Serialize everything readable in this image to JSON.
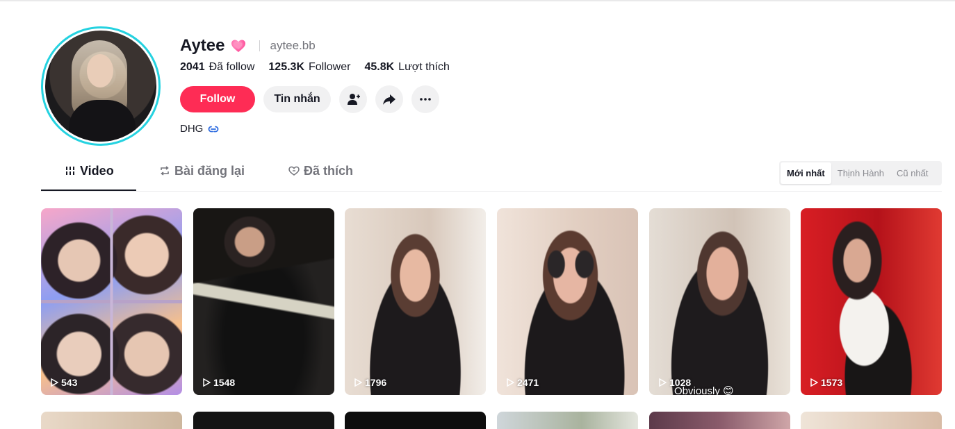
{
  "profile": {
    "name": "Aytee",
    "handle": "aytee.bb",
    "heart_icon": "pink-heart-emoji",
    "stats": [
      {
        "value": "2041",
        "label": "Đã follow"
      },
      {
        "value": "125.3K",
        "label": "Follower"
      },
      {
        "value": "45.8K",
        "label": "Lượt thích"
      }
    ],
    "bio": "DHG",
    "colors": {
      "accent": "#fe2c55",
      "ring": "#25d2e0",
      "link": "#2d6be0"
    }
  },
  "actions": {
    "follow_label": "Follow",
    "message_label": "Tin nhắn",
    "add_friend_icon": "add-user-icon",
    "share_icon": "share-icon",
    "more_icon": "more-icon"
  },
  "tabs": [
    {
      "label": "Video",
      "icon": "grid-bars-icon",
      "active": true
    },
    {
      "label": "Bài đăng lại",
      "icon": "repost-icon",
      "active": false
    },
    {
      "label": "Đã thích",
      "icon": "heart-outline-icon",
      "active": false
    }
  ],
  "sort": {
    "options": [
      "Mới nhất",
      "Thịnh Hành",
      "Cũ nhất"
    ],
    "selected": "Mới nhất"
  },
  "videos": [
    {
      "views": "543"
    },
    {
      "views": "1548"
    },
    {
      "views": "1796"
    },
    {
      "views": "2471"
    },
    {
      "views": "1028",
      "caption": "Obviously 😊"
    },
    {
      "views": "1573"
    }
  ]
}
